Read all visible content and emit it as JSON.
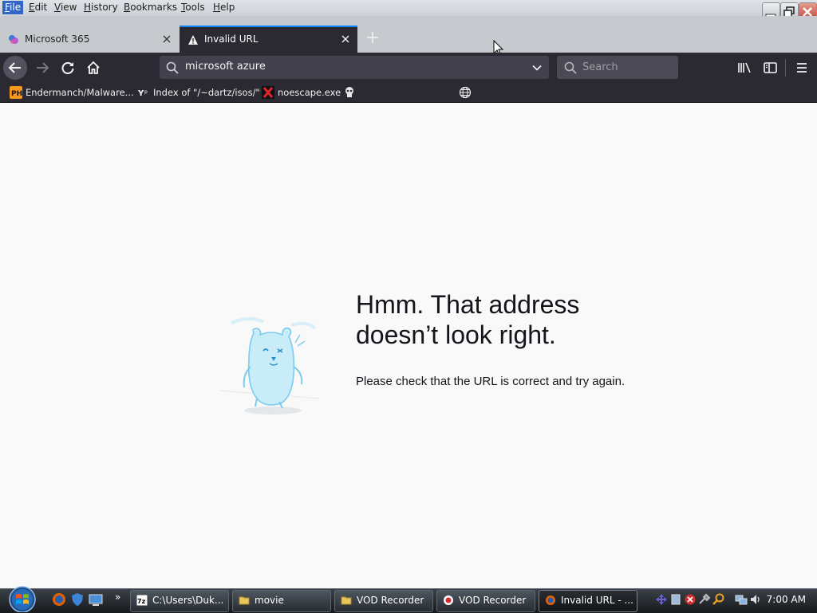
{
  "menubar": {
    "items": [
      "File",
      "Edit",
      "View",
      "History",
      "Bookmarks",
      "Tools",
      "Help"
    ]
  },
  "tabs": [
    {
      "label": "Microsoft 365",
      "icon": "microsoft365-icon",
      "active": false
    },
    {
      "label": "Invalid URL",
      "icon": "warning-icon",
      "active": true
    }
  ],
  "urlbar": {
    "value": "microsoft azure"
  },
  "searchbar": {
    "placeholder": "Search"
  },
  "bookmarks": [
    {
      "label": "Endermanch/Malware...",
      "icon": "ph-icon"
    },
    {
      "label": "Index of \"/~dartz/isos/\"",
      "icon": "ycombinator-icon"
    },
    {
      "label": "noescape.exe",
      "icon": "red-x-icon"
    },
    {
      "label": "",
      "icon": "skull-icon"
    },
    {
      "label": "",
      "icon": "globe-icon"
    }
  ],
  "error_page": {
    "title": "Hmm. That address doesn’t look right.",
    "description": "Please check that the URL is correct and try again."
  },
  "taskbar": {
    "tasks": [
      {
        "label": "C:\\Users\\Duk...",
        "icon": "7zip-icon",
        "active": false
      },
      {
        "label": "movie",
        "icon": "folder-icon",
        "active": false
      },
      {
        "label": "VOD Recorder",
        "icon": "folder-icon",
        "active": false
      },
      {
        "label": "VOD Recorder",
        "icon": "record-icon",
        "active": false
      },
      {
        "label": "Invalid URL - ...",
        "icon": "firefox-icon",
        "active": true
      }
    ],
    "clock": "7:00 AM"
  },
  "colors": {
    "accent": "#0a84ff",
    "toolbar": "#2b2a33",
    "content_bg": "#f9f9fa"
  }
}
